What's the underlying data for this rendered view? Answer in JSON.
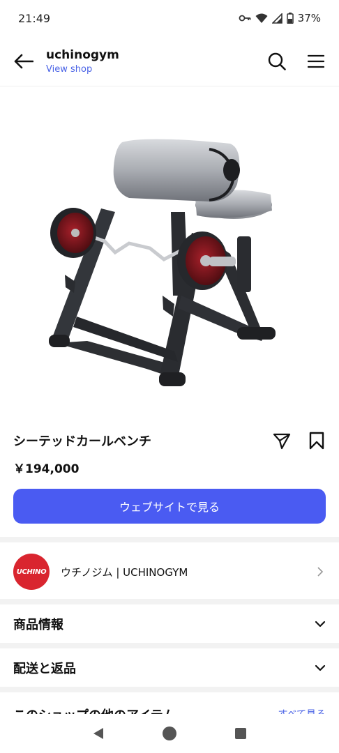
{
  "status": {
    "time": "21:49",
    "battery": "37%"
  },
  "header": {
    "shop_name": "uchinogym",
    "view_shop": "View shop"
  },
  "product": {
    "title": "シーテッドカールベンチ",
    "price": "￥194,000",
    "cta_label": "ウェブサイトで見る"
  },
  "seller": {
    "logo_text": "UCHINO",
    "name": "ウチノジム | UCHINOGYM"
  },
  "sections": {
    "product_info": "商品情報",
    "shipping_returns": "配送と返品"
  },
  "more": {
    "title": "このショップの他のアイテム",
    "link": "すべて見る"
  },
  "colors": {
    "accent": "#4a5bf2",
    "link": "#4a63e6",
    "logo_red": "#d9252f"
  },
  "icons": [
    "back-arrow-icon",
    "search-icon",
    "menu-icon",
    "share-icon",
    "bookmark-icon",
    "chevron-right-icon",
    "chevron-down-icon",
    "nav-back-icon",
    "nav-home-icon",
    "nav-recents-icon"
  ]
}
